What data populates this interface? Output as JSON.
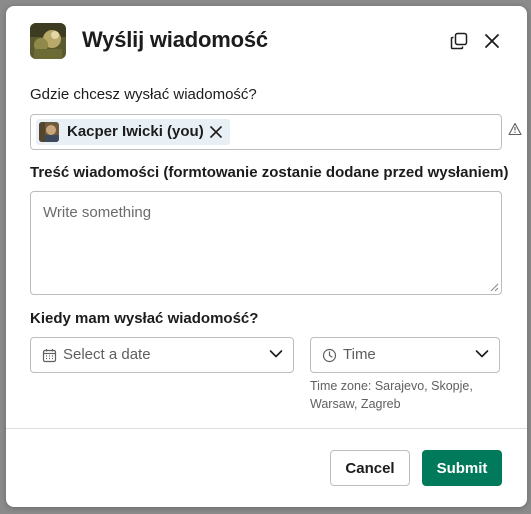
{
  "modal": {
    "title": "Wyślij wiadomość",
    "recipient_label": "Gdzie chcesz wysłać wiadomość?",
    "recipient_chip": "Kacper Iwicki (you)",
    "message_label": "Treść wiadomości (formtowanie zostanie dodane przed wysłaniem)",
    "message_placeholder": "Write something",
    "when_label": "Kiedy mam wysłać wiadomość?",
    "date_placeholder": "Select a date",
    "time_placeholder": "Time",
    "timezone_note": "Time zone: Sarajevo, Skopje, Warsaw, Zagreb",
    "cancel_label": "Cancel",
    "submit_label": "Submit"
  },
  "icons": {
    "header": [
      "app-icon",
      "duplicate-icon",
      "close-icon"
    ],
    "chip": [
      "avatar",
      "remove-icon"
    ],
    "fields": [
      "warning-icon",
      "calendar-icon",
      "clock-icon",
      "chevron-down-icon"
    ]
  },
  "colors": {
    "submit_bg": "#007a5a",
    "chip_bg": "#e8f0f6",
    "overlay": "#8b8b8b"
  }
}
